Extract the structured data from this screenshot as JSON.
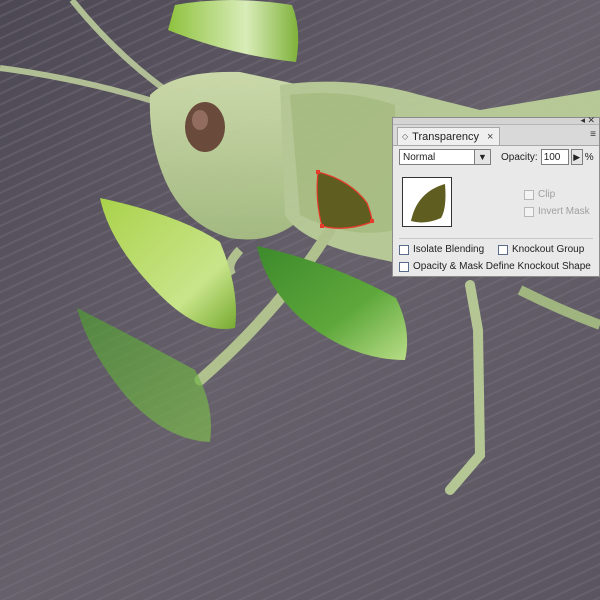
{
  "panel": {
    "tab_title": "Transparency",
    "tab_close": "×",
    "menu_icon": "≡",
    "collapse_glyph": "◂",
    "close_glyph": "✕",
    "blend_mode": "Normal",
    "opacity_label": "Opacity:",
    "opacity_value": "100",
    "opacity_unit": "%",
    "clip_label": "Clip",
    "invert_mask_label": "Invert Mask",
    "isolate_blending_label": "Isolate Blending",
    "knockout_group_label": "Knockout Group",
    "knockout_shape_label": "Opacity & Mask Define Knockout Shape"
  },
  "colors": {
    "leaf_dark": "#5f5d1f",
    "selection_red": "#e63a2a",
    "panel_bg": "#e9e9e9"
  }
}
